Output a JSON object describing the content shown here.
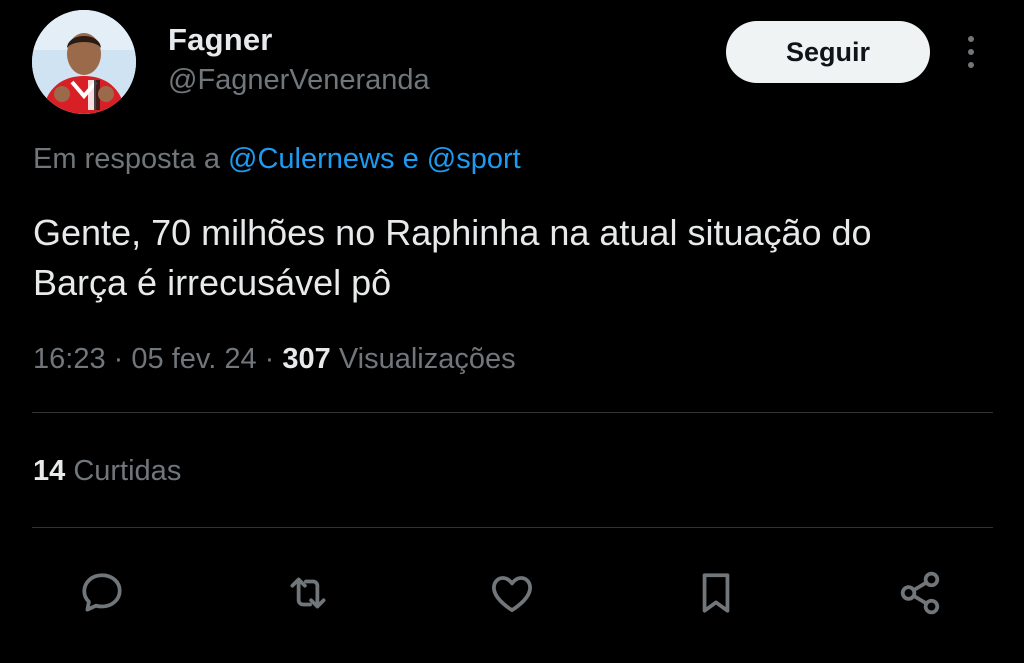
{
  "author": {
    "display_name": "Fagner",
    "handle": "@FagnerVeneranda"
  },
  "follow_label": "Seguir",
  "reply_context": {
    "prefix": "Em resposta a",
    "mention_1": "@Culernews",
    "joiner": "e",
    "mention_2": "@sport"
  },
  "tweet": {
    "line_1": "Gente, 70 milhões no Raphinha na atual situação do",
    "line_2": "Barça é irrecusável pô"
  },
  "meta": {
    "time": "16:23",
    "sep_1": "·",
    "date": "05 fev. 24",
    "sep_2": "·",
    "views_count": "307",
    "views_label": "Visualizações"
  },
  "likes": {
    "count": "14",
    "label": "Curtidas"
  },
  "actions": [
    "reply-icon",
    "retweet-icon",
    "like-icon",
    "bookmark-icon",
    "share-icon"
  ],
  "colors": {
    "background": "#000000",
    "text": "#e7e9ea",
    "muted": "#71767b",
    "link": "#1d9bf0",
    "divider": "#2f3336"
  }
}
